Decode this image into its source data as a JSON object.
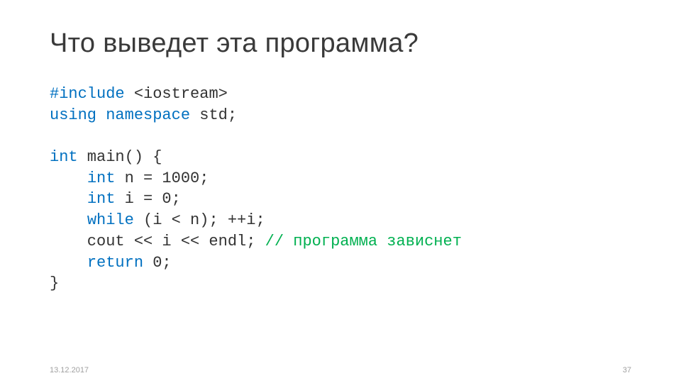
{
  "title": "Что выведет эта программа?",
  "code": {
    "l1a": "#include",
    "l1b": " <iostream>",
    "l2a": "using",
    "l2b": " ",
    "l2c": "namespace",
    "l2d": " std;",
    "l3a": "int",
    "l3b": " main() {",
    "l4a": "    ",
    "l4b": "int",
    "l4c": " n = 1000;",
    "l5a": "    ",
    "l5b": "int",
    "l5c": " i = 0;",
    "l6a": "    ",
    "l6b": "while",
    "l6c": " (i < n); ++i;",
    "l7a": "    cout << i << endl; ",
    "l7b": "// программа зависнет",
    "l8a": "    ",
    "l8b": "return",
    "l8c": " 0;",
    "l9": "}"
  },
  "footer": {
    "date": "13.12.2017",
    "page": "37"
  }
}
